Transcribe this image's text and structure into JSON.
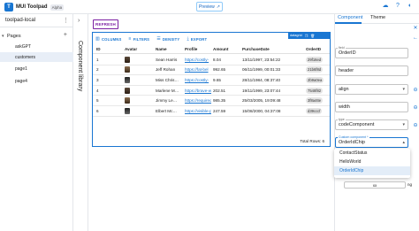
{
  "app": {
    "logo_letter": "T",
    "title": "MUI Toolpad",
    "badge": "Alpha",
    "preview_label": "Preview"
  },
  "sidebar": {
    "app_name": "toolpad-local",
    "pages_label": "Pages",
    "pages": [
      "askGPT",
      "customers",
      "page1",
      "page4"
    ],
    "selected_page": "customers"
  },
  "component_library": {
    "label": "Component library"
  },
  "canvas": {
    "refresh_label": "REFRESH",
    "grid": {
      "badge": "datagrid",
      "toolbar": [
        "COLUMNS",
        "FILTERS",
        "DENSITY",
        "EXPORT"
      ],
      "columns": [
        "ID",
        "Avatar",
        "Name",
        "Profile",
        "Amount",
        "PurchaseDate",
        "OrderID"
      ],
      "rows": [
        {
          "id": "1",
          "name": "Sean Harris",
          "profile": "https://costly-",
          "amount": "8.04",
          "date": "13/11/1997, 23:54:22",
          "order": "29f16ed"
        },
        {
          "id": "2",
          "name": "Jeff Rohan",
          "profile": "https://fat-bel",
          "amount": "992.65",
          "date": "06/11/1999, 00:01:33",
          "order": "21b6f8d"
        },
        {
          "id": "3",
          "name": "Miss Chris…",
          "profile": "https://costly-",
          "amount": "9.65",
          "date": "28/11/1984, 08:37:40",
          "order": "2b9a0ea"
        },
        {
          "id": "4",
          "name": "Marlene M…",
          "profile": "https://brave-w",
          "amount": "202.51",
          "date": "19/11/1999, 23:07:44",
          "order": "7548f82"
        },
        {
          "id": "5",
          "name": "Jimmy Le…",
          "profile": "https://required",
          "amount": "985.35",
          "date": "25/03/2005, 19:09:48",
          "order": "3f8a46e"
        },
        {
          "id": "6",
          "name": "Elbert Mc…",
          "profile": "https://visible-p",
          "amount": "247.59",
          "date": "15/08/2000, 04:37:08",
          "order": "d39cccf"
        }
      ],
      "footer": "Total Rows: 6"
    }
  },
  "right_panel": {
    "tabs": [
      "Component",
      "Theme"
    ],
    "active_tab": "Component",
    "field_label": "field",
    "field_value": "OrderID",
    "header_value": "header",
    "align_value": "align",
    "width_value": "width",
    "type_label": "type",
    "type_value": "codeComponent",
    "custom_label": "Custom component *",
    "custom_value": "OrderIdChip",
    "options": [
      "ContactStatus",
      "HelloWorld",
      "OrderIdChip"
    ],
    "selected_option": "OrderIdChip",
    "mini_value": "xx",
    "mini_tail": "ng"
  }
}
